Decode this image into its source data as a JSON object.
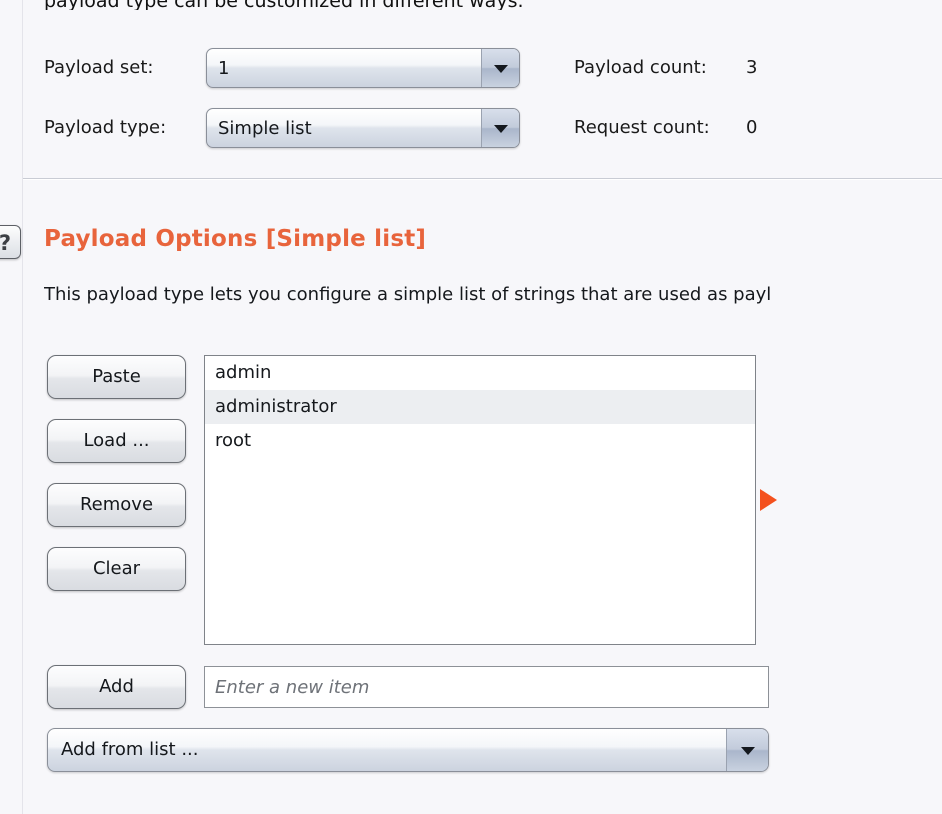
{
  "intro": {
    "clipped_text": "payload type can be customized in different ways."
  },
  "payload_config": {
    "payload_set": {
      "label": "Payload set:",
      "value": "1",
      "arrow_icon": "chevron-down-icon"
    },
    "payload_type": {
      "label": "Payload type:",
      "value": "Simple list",
      "arrow_icon": "chevron-down-icon"
    },
    "payload_count": {
      "label": "Payload count:",
      "value": "3"
    },
    "request_count": {
      "label": "Request count:",
      "value": "0"
    }
  },
  "payload_options": {
    "help_icon": "?",
    "heading": "Payload Options [Simple list]",
    "heading_color": "#e8643c",
    "description": "This payload type lets you configure a simple list of strings that are used as payl",
    "buttons": [
      {
        "label": "Paste"
      },
      {
        "label": "Load ..."
      },
      {
        "label": "Remove"
      },
      {
        "label": "Clear"
      }
    ],
    "list_items": [
      {
        "value": "admin"
      },
      {
        "value": "administrator"
      },
      {
        "value": "root"
      }
    ],
    "add_button": {
      "label": "Add"
    },
    "new_item_input": {
      "placeholder": "Enter a new item",
      "value": ""
    },
    "add_from_list": {
      "value": "Add from list ...",
      "arrow_icon": "chevron-down-icon"
    },
    "marker_color": "#f4511e"
  }
}
